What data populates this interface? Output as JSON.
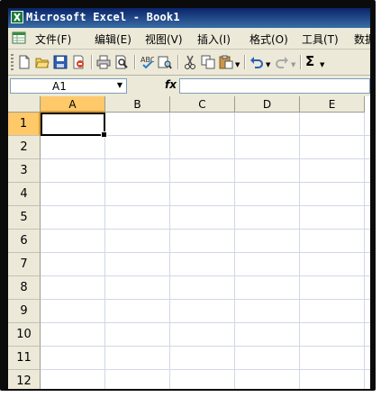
{
  "window": {
    "title": "Microsoft Excel - Book1"
  },
  "menu": {
    "items": [
      {
        "label": "文件(F)"
      },
      {
        "label": "编辑(E)"
      },
      {
        "label": "视图(V)"
      },
      {
        "label": "插入(I)"
      },
      {
        "label": "格式(O)"
      },
      {
        "label": "工具(T)"
      },
      {
        "label": "数据"
      }
    ]
  },
  "toolbar": {
    "icons": [
      "new-icon",
      "open-icon",
      "save-icon",
      "permission-icon",
      "print-icon",
      "print-preview-icon",
      "spelling-icon",
      "research-icon",
      "cut-icon",
      "copy-icon",
      "paste-icon",
      "undo-icon",
      "redo-icon",
      "autosum-icon"
    ],
    "autosum_label": "Σ"
  },
  "formula_bar": {
    "name_box": "A1",
    "fx_label": "fx",
    "formula": ""
  },
  "sheet": {
    "columns": [
      "A",
      "B",
      "C",
      "D",
      "E"
    ],
    "rows": [
      "1",
      "2",
      "3",
      "4",
      "5",
      "6",
      "7",
      "8",
      "9",
      "10",
      "11",
      "12"
    ],
    "active_cell": "A1"
  },
  "colors": {
    "title_bar": "#0a246a",
    "header_selected": "#ffc869",
    "grid_line": "#d0d7e5"
  }
}
